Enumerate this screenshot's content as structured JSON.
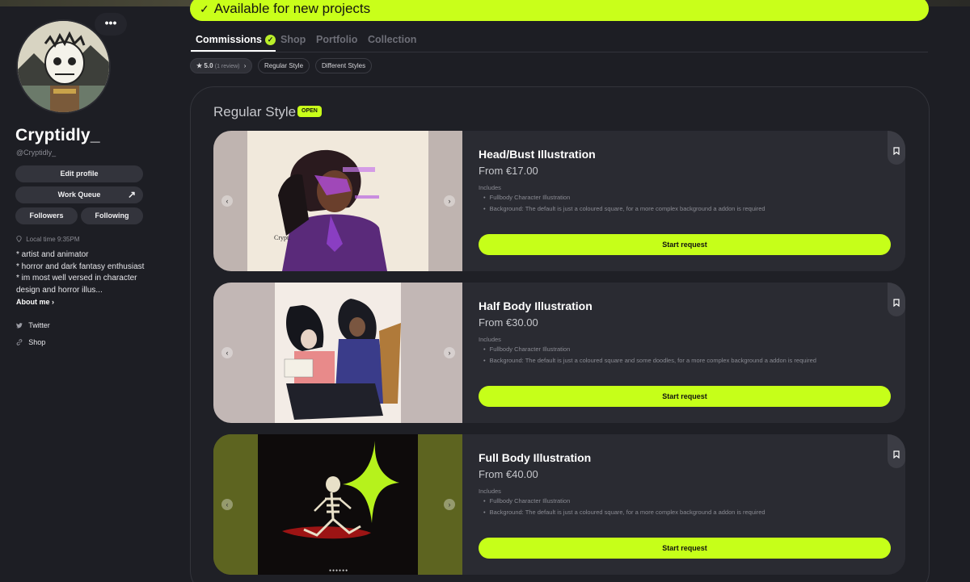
{
  "profile": {
    "name": "Cryptidly_",
    "handle": "@Cryptidly_",
    "more_label": "•••",
    "edit_profile": "Edit profile",
    "work_queue": "Work Queue",
    "work_queue_arrow": "↗",
    "followers": "Followers",
    "following": "Following",
    "local_time": "Local time 9:35PM",
    "bio_lines": [
      "* artist and animator",
      "* horror and dark fantasy enthusiast",
      "* im most well versed in character design and horror illus..."
    ],
    "about_me": "About me ›",
    "links": [
      "Twitter",
      "Shop"
    ]
  },
  "banner": {
    "check": "✓",
    "text": "Available for new projects"
  },
  "tabs": {
    "items": [
      "Commissions",
      "Shop",
      "Portfolio",
      "Collection"
    ],
    "verified_icon": "✓"
  },
  "chips": {
    "rating": "★ 5.0",
    "reviews": "(1 review)",
    "rating_arrow": "›",
    "style1": "Regular Style",
    "style2": "Different Styles"
  },
  "section": {
    "title": "Regular Style",
    "badge": "OPEN"
  },
  "cards": [
    {
      "title": "Head/Bust Illustration",
      "price": "From €17.00",
      "includes": "Includes",
      "items": [
        "Fullbody Character Illustration",
        "Background: The default is just a coloured square, for a more complex background a addon is required"
      ],
      "button": "Start request"
    },
    {
      "title": "Half Body Illustration",
      "price": "From €30.00",
      "includes": "Includes",
      "items": [
        "Fullbody Character Illustration",
        "Background: The default is just a coloured square and some doodles, for a more complex background a addon is required"
      ],
      "button": "Start request"
    },
    {
      "title": "Full Body Illustration",
      "price": "From €40.00",
      "includes": "Includes",
      "items": [
        "Fullbody Character Illustration",
        "Background: The default is just a coloured square, for a more complex background a addon is required"
      ],
      "button": "Start request"
    }
  ],
  "colors": {
    "accent": "#c9ff1a",
    "background": "#1d1e24",
    "card": "#2a2b32"
  },
  "icons": {
    "bookmark": "bookmark-icon",
    "prev": "‹",
    "next": "›",
    "location": "location-pin-icon",
    "twitter": "twitter-icon",
    "link": "link-icon"
  }
}
